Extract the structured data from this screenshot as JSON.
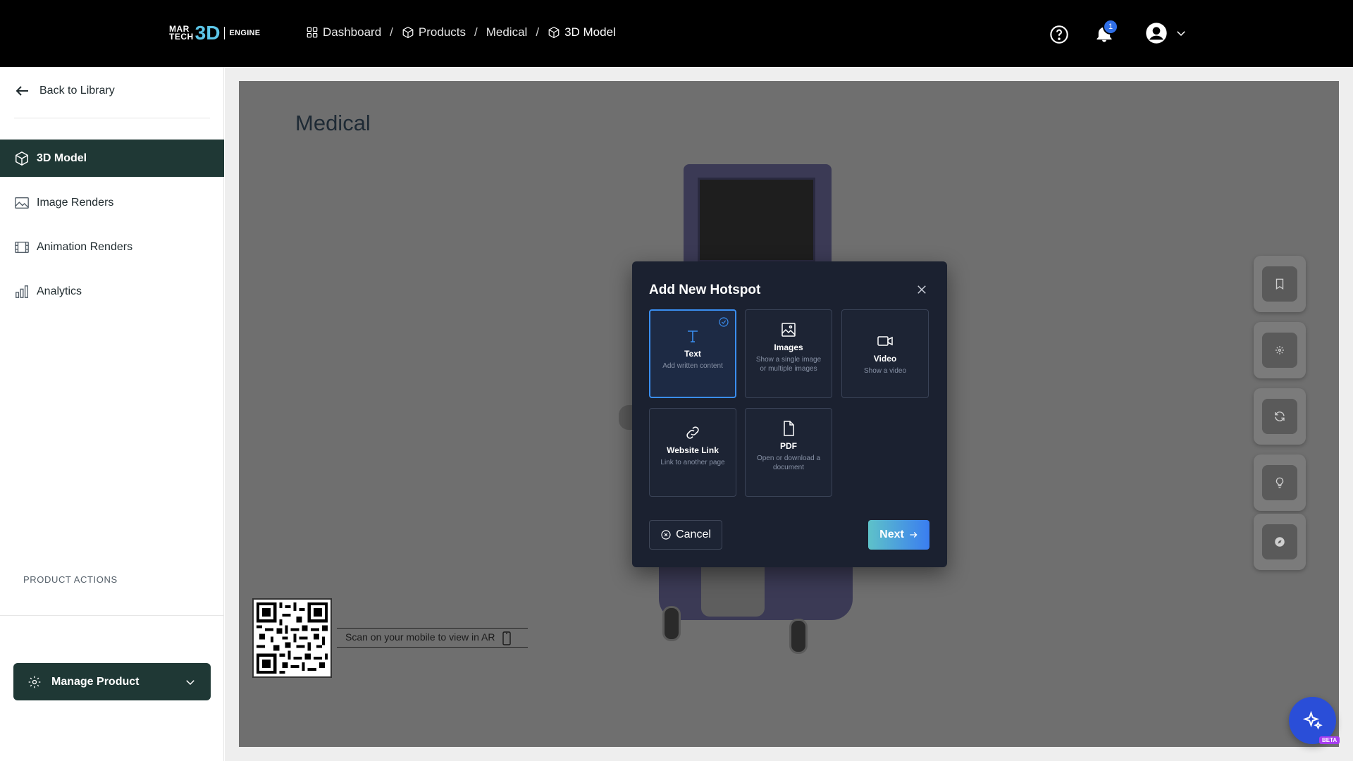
{
  "header": {
    "logo": {
      "top": "MAR",
      "bottom": "TECH",
      "mark": "3D",
      "suffix": "ENGINE"
    },
    "breadcrumbs": [
      {
        "label": "Dashboard",
        "icon": "grid-icon"
      },
      {
        "label": "Products",
        "icon": "cube-icon"
      },
      {
        "label": "Medical",
        "icon": ""
      },
      {
        "label": "3D Model",
        "icon": "cube-icon"
      }
    ],
    "notification_count": "1"
  },
  "sidebar": {
    "back_label": "Back to Library",
    "items": [
      {
        "label": "3D Model",
        "icon": "cube-icon",
        "active": true
      },
      {
        "label": "Image Renders",
        "icon": "image-icon",
        "active": false
      },
      {
        "label": "Animation Renders",
        "icon": "film-icon",
        "active": false
      },
      {
        "label": "Analytics",
        "icon": "bar-chart-icon",
        "active": false
      }
    ],
    "product_actions_label": "PRODUCT ACTIONS",
    "manage_label": "Manage Product"
  },
  "viewer": {
    "title": "Medical",
    "qr_label": "Scan on your mobile to view in AR"
  },
  "modal": {
    "title": "Add New Hotspot",
    "options": [
      {
        "title": "Text",
        "desc": "Add written content",
        "icon": "text-icon",
        "selected": true
      },
      {
        "title": "Images",
        "desc": "Show a single image or multiple images",
        "icon": "image-icon",
        "selected": false
      },
      {
        "title": "Video",
        "desc": "Show a video",
        "icon": "video-icon",
        "selected": false
      },
      {
        "title": "Website Link",
        "desc": "Link to another page",
        "icon": "link-icon",
        "selected": false
      },
      {
        "title": "PDF",
        "desc": "Open or download a document",
        "icon": "file-icon",
        "selected": false
      }
    ],
    "cancel_label": "Cancel",
    "next_label": "Next"
  },
  "fab": {
    "badge": "BETA"
  },
  "colors": {
    "topbar": "#000000",
    "sidebar_active": "#1f3835",
    "accent_blue": "#3a8ef0",
    "logo_accent": "#5cc6e8",
    "modal_bg": "#1b2130",
    "viewer_bg": "#6f6f6f"
  }
}
